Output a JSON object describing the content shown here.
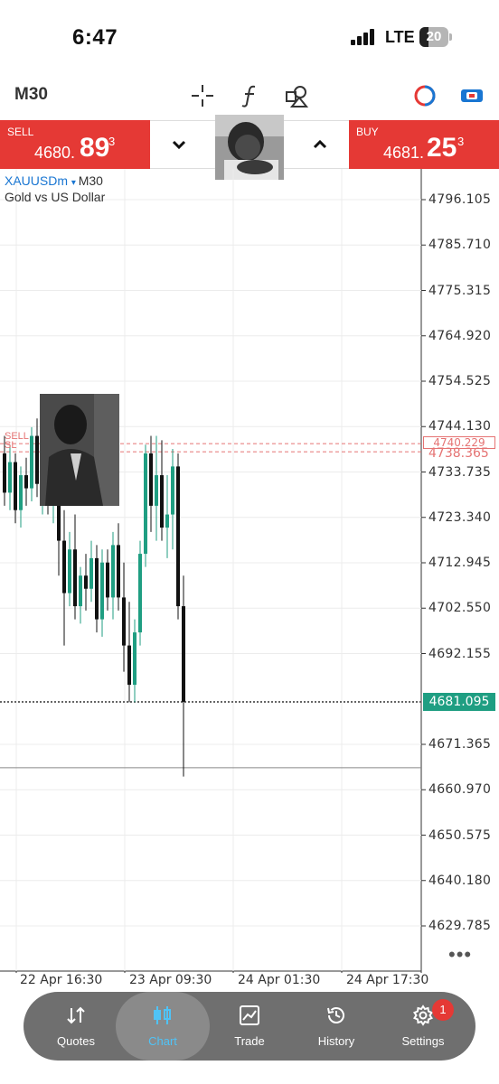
{
  "status_bar": {
    "time": "6:47",
    "network": "LTE",
    "battery": "20"
  },
  "toolbar": {
    "timeframe": "M30",
    "icons": [
      "crosshair-icon",
      "function-icon",
      "objects-icon",
      "color-scheme-icon",
      "account-icon"
    ]
  },
  "trade": {
    "sell": {
      "label": "SELL",
      "price_small": "4680.",
      "price_big": "89",
      "price_sup": "3"
    },
    "buy": {
      "label": "BUY",
      "price_small": "4681.",
      "price_big": "25",
      "price_sup": "3"
    }
  },
  "chart": {
    "symbol": "XAUUSDm",
    "symbol_timeframe": "M30",
    "description": "Gold vs US Dollar",
    "line_labels": {
      "sell": "SELL",
      "sl": "SL"
    },
    "sl_tag": "4740.229",
    "sl_value": "4738.365",
    "current_price": "4681.095",
    "price_levels": [
      "4796.105",
      "4785.710",
      "4775.315",
      "4764.920",
      "4754.525",
      "4744.130",
      "4733.735",
      "4723.340",
      "4712.945",
      "4702.550",
      "4692.155",
      "4671.365",
      "4660.970",
      "4650.575",
      "4640.180",
      "4629.785"
    ],
    "time_labels": [
      "22 Apr 16:30",
      "23 Apr 09:30",
      "24 Apr 01:30",
      "24 Apr 17:30"
    ],
    "more": "•••"
  },
  "chart_data": {
    "type": "candlestick",
    "symbol": "XAUUSDm",
    "timeframe": "M30",
    "ylim": [
      4625,
      4800
    ],
    "candles": [
      {
        "o": 4738,
        "h": 4742,
        "l": 4726,
        "c": 4729,
        "dir": "down"
      },
      {
        "o": 4729,
        "h": 4740,
        "l": 4725,
        "c": 4736,
        "dir": "up"
      },
      {
        "o": 4736,
        "h": 4738,
        "l": 4722,
        "c": 4725,
        "dir": "down"
      },
      {
        "o": 4725,
        "h": 4735,
        "l": 4721,
        "c": 4733,
        "dir": "up"
      },
      {
        "o": 4733,
        "h": 4737,
        "l": 4726,
        "c": 4730,
        "dir": "down"
      },
      {
        "o": 4730,
        "h": 4744,
        "l": 4727,
        "c": 4742,
        "dir": "up"
      },
      {
        "o": 4742,
        "h": 4746,
        "l": 4728,
        "c": 4731,
        "dir": "down"
      },
      {
        "o": 4731,
        "h": 4741,
        "l": 4724,
        "c": 4738,
        "dir": "up"
      },
      {
        "o": 4738,
        "h": 4740,
        "l": 4724,
        "c": 4726,
        "dir": "down"
      },
      {
        "o": 4726,
        "h": 4736,
        "l": 4722,
        "c": 4733,
        "dir": "up"
      },
      {
        "o": 4733,
        "h": 4737,
        "l": 4710,
        "c": 4718,
        "dir": "down"
      },
      {
        "o": 4718,
        "h": 4725,
        "l": 4694,
        "c": 4706,
        "dir": "down"
      },
      {
        "o": 4706,
        "h": 4720,
        "l": 4703,
        "c": 4716,
        "dir": "up"
      },
      {
        "o": 4716,
        "h": 4724,
        "l": 4700,
        "c": 4703,
        "dir": "down"
      },
      {
        "o": 4703,
        "h": 4712,
        "l": 4699,
        "c": 4710,
        "dir": "up"
      },
      {
        "o": 4710,
        "h": 4715,
        "l": 4702,
        "c": 4707,
        "dir": "down"
      },
      {
        "o": 4707,
        "h": 4718,
        "l": 4704,
        "c": 4714,
        "dir": "up"
      },
      {
        "o": 4714,
        "h": 4717,
        "l": 4697,
        "c": 4700,
        "dir": "down"
      },
      {
        "o": 4700,
        "h": 4716,
        "l": 4696,
        "c": 4713,
        "dir": "up"
      },
      {
        "o": 4713,
        "h": 4716,
        "l": 4702,
        "c": 4705,
        "dir": "down"
      },
      {
        "o": 4705,
        "h": 4720,
        "l": 4700,
        "c": 4717,
        "dir": "up"
      },
      {
        "o": 4717,
        "h": 4722,
        "l": 4702,
        "c": 4705,
        "dir": "down"
      },
      {
        "o": 4705,
        "h": 4713,
        "l": 4688,
        "c": 4694,
        "dir": "down"
      },
      {
        "o": 4694,
        "h": 4704,
        "l": 4681,
        "c": 4685,
        "dir": "down"
      },
      {
        "o": 4685,
        "h": 4700,
        "l": 4681,
        "c": 4697,
        "dir": "up"
      },
      {
        "o": 4697,
        "h": 4718,
        "l": 4694,
        "c": 4715,
        "dir": "up"
      },
      {
        "o": 4715,
        "h": 4740,
        "l": 4712,
        "c": 4738,
        "dir": "up"
      },
      {
        "o": 4738,
        "h": 4742,
        "l": 4720,
        "c": 4726,
        "dir": "down"
      },
      {
        "o": 4726,
        "h": 4742,
        "l": 4718,
        "c": 4733,
        "dir": "up"
      },
      {
        "o": 4733,
        "h": 4741,
        "l": 4718,
        "c": 4721,
        "dir": "down"
      },
      {
        "o": 4721,
        "h": 4733,
        "l": 4714,
        "c": 4724,
        "dir": "up"
      },
      {
        "o": 4724,
        "h": 4739,
        "l": 4716,
        "c": 4735,
        "dir": "up"
      },
      {
        "o": 4735,
        "h": 4738,
        "l": 4700,
        "c": 4703,
        "dir": "down"
      },
      {
        "o": 4703,
        "h": 4710,
        "l": 4664,
        "c": 4681.1,
        "dir": "down"
      }
    ],
    "lines": {
      "sl": 4740.229,
      "sell": 4738.365,
      "current": 4681.095,
      "gray_line": 4666
    },
    "colors": {
      "up": "#1f9e82",
      "down": "#111111",
      "sl": "#e57373",
      "current": "#1f9e82"
    }
  },
  "nav": {
    "items": [
      {
        "label": "Quotes",
        "icon": "quotes-icon"
      },
      {
        "label": "Chart",
        "icon": "chart-icon"
      },
      {
        "label": "Trade",
        "icon": "trade-icon"
      },
      {
        "label": "History",
        "icon": "history-icon"
      },
      {
        "label": "Settings",
        "icon": "settings-icon"
      }
    ],
    "active": "Chart",
    "settings_badge": "1"
  },
  "colors": {
    "sell": "#e53935",
    "buy": "#e53935",
    "accent": "#4fc3f7",
    "nav_bg": "#6f6f6f"
  }
}
